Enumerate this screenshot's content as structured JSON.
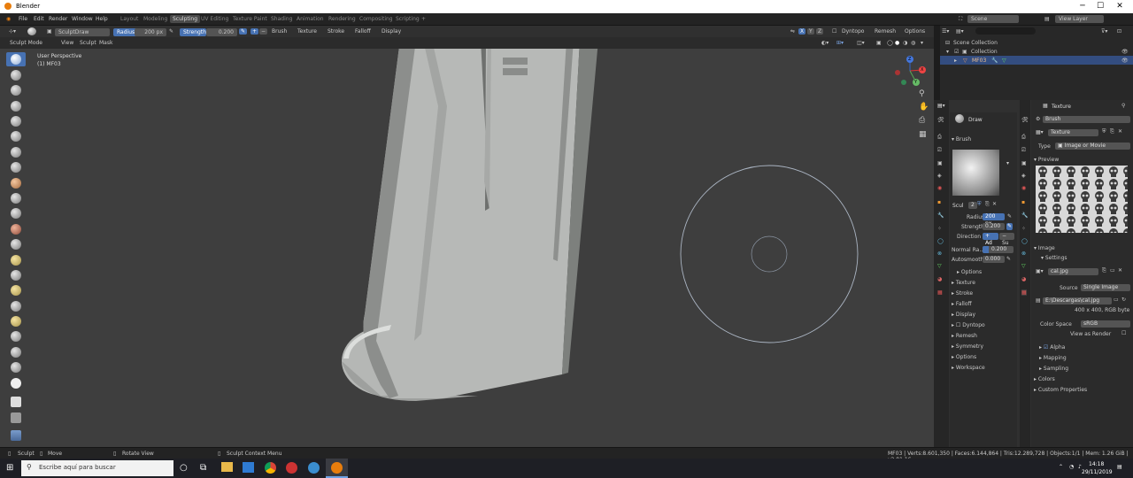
{
  "window": {
    "title": "Blender",
    "minimize": "─",
    "maximize": "☐",
    "close": "✕"
  },
  "menu": {
    "items": [
      "File",
      "Edit",
      "Render",
      "Window",
      "Help"
    ],
    "workspaces": [
      "Layout",
      "Modeling",
      "Sculpting",
      "UV Editing",
      "Texture Paint",
      "Shading",
      "Animation",
      "Rendering",
      "Compositing",
      "Scripting"
    ],
    "active_workspace": "Sculpting",
    "add": "+",
    "scene": "Scene",
    "view_layer": "View Layer"
  },
  "tool_header": {
    "brush_name": "SculptDraw",
    "radius_label": "Radius",
    "radius_value": "200 px",
    "strength_label": "Strength",
    "strength_value": "0.200",
    "plus": "+",
    "minus": "−",
    "menus": [
      "Brush",
      "Texture",
      "Stroke",
      "Falloff",
      "Display"
    ],
    "xyz": [
      "X",
      "Y",
      "Z"
    ],
    "dyntopo": "Dyntopo",
    "remesh": "Remesh",
    "options": "Options"
  },
  "mode_header": {
    "mode": "Sculpt Mode",
    "menus": [
      "View",
      "Sculpt",
      "Mask"
    ]
  },
  "viewport": {
    "view_name": "User Perspective",
    "object_label": "(1) MF03",
    "gizmo": {
      "x": "X",
      "y": "Y",
      "z": "Z"
    }
  },
  "outliner": {
    "scene_collection": "Scene Collection",
    "collection": "Collection",
    "object": "MF03"
  },
  "brush_panel": {
    "brush_name": "Draw",
    "section": "Brush",
    "slot_name": "Scul",
    "users": "2",
    "fields": [
      {
        "label": "Radius",
        "value": "200 px"
      },
      {
        "label": "Strength",
        "value": "0.200"
      }
    ],
    "direction_label": "Direction",
    "direction_add": "+ Ad",
    "direction_sub": "− Su",
    "normal_radius_label": "Normal Ra...",
    "normal_radius_value": "0.200",
    "autosmooth_label": "Autosmooth",
    "autosmooth_value": "0.000",
    "sections": [
      "Options",
      "Texture",
      "Stroke",
      "Falloff",
      "Display",
      "Dyntopo",
      "Remesh",
      "Symmetry",
      "Options",
      "Workspace"
    ]
  },
  "texture_panel": {
    "title": "Texture",
    "context": "Brush",
    "texture_name": "Texture",
    "type_label": "Type",
    "type_value": "Image or Movie",
    "preview_label": "Preview",
    "image_label": "Image",
    "settings_label": "Settings",
    "image_name": "cal.jpg",
    "source_label": "Source",
    "source_value": "Single Image",
    "path": "E:\\Descargas\\cal.jpg",
    "info": "400 x 400,  RGB byte",
    "color_space_label": "Color Space",
    "color_space_value": "sRGB",
    "view_as_render": "View as Render",
    "alpha": "Alpha",
    "mapping": "Mapping",
    "sampling": "Sampling",
    "colors": "Colors",
    "custom_props": "Custom Properties"
  },
  "status": {
    "sculpt": "Sculpt",
    "move": "Move",
    "rotate": "Rotate View",
    "context": "Sculpt Context Menu",
    "stats": "MF03 | Verts:8.601,350 | Faces:6.144,864 | Tris:12.289,728 | Objects:1/1 | Mem: 1.26 GiB | v2.81.16"
  },
  "taskbar": {
    "search_placeholder": "Escribe aquí para buscar",
    "time": "14:18",
    "date": "29/11/2019"
  },
  "colors": {
    "accent": "#4772b3",
    "viewport": "#3e3e3e",
    "mesh": "#b8bab8",
    "blender_orange": "#e87d0d"
  }
}
